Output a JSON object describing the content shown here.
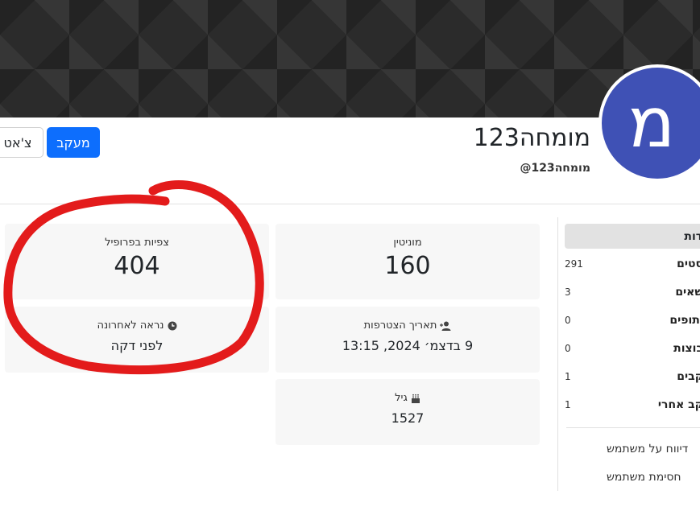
{
  "profile": {
    "avatar_letter": "מ",
    "display_name": "מומחה123",
    "username": "@מומחה123",
    "avatar_color": "#3f51b5"
  },
  "actions": {
    "follow_label": "מעקב",
    "chat_label": "צ'אט"
  },
  "stats": {
    "profile_views_label": "צפיות בפרופיל",
    "profile_views_value": "404",
    "reputation_label": "מוניטין",
    "reputation_value": "160",
    "last_seen_label": "נראה לאחרונה",
    "last_seen_value": "לפני דקה",
    "joined_label": "תאריך הצטרפות",
    "joined_value": "9 בדצמ׳ 2024, 13:15",
    "age_label": "גיל",
    "age_value": "1527"
  },
  "sidebar": {
    "header": "דות",
    "items": [
      {
        "label": "סטים",
        "count": "291"
      },
      {
        "label": "שאים",
        "count": "3"
      },
      {
        "label": "יתופים",
        "count": "0"
      },
      {
        "label": "בוצות",
        "count": "0"
      },
      {
        "label": "קבים",
        "count": "1"
      },
      {
        "label": "קב אחרי",
        "count": "1"
      }
    ],
    "report_label": "דיווח על משתמש",
    "block_label": "חסימת משתמש"
  },
  "colors": {
    "primary": "#0d6efd",
    "annotation": "#e31b1b"
  }
}
